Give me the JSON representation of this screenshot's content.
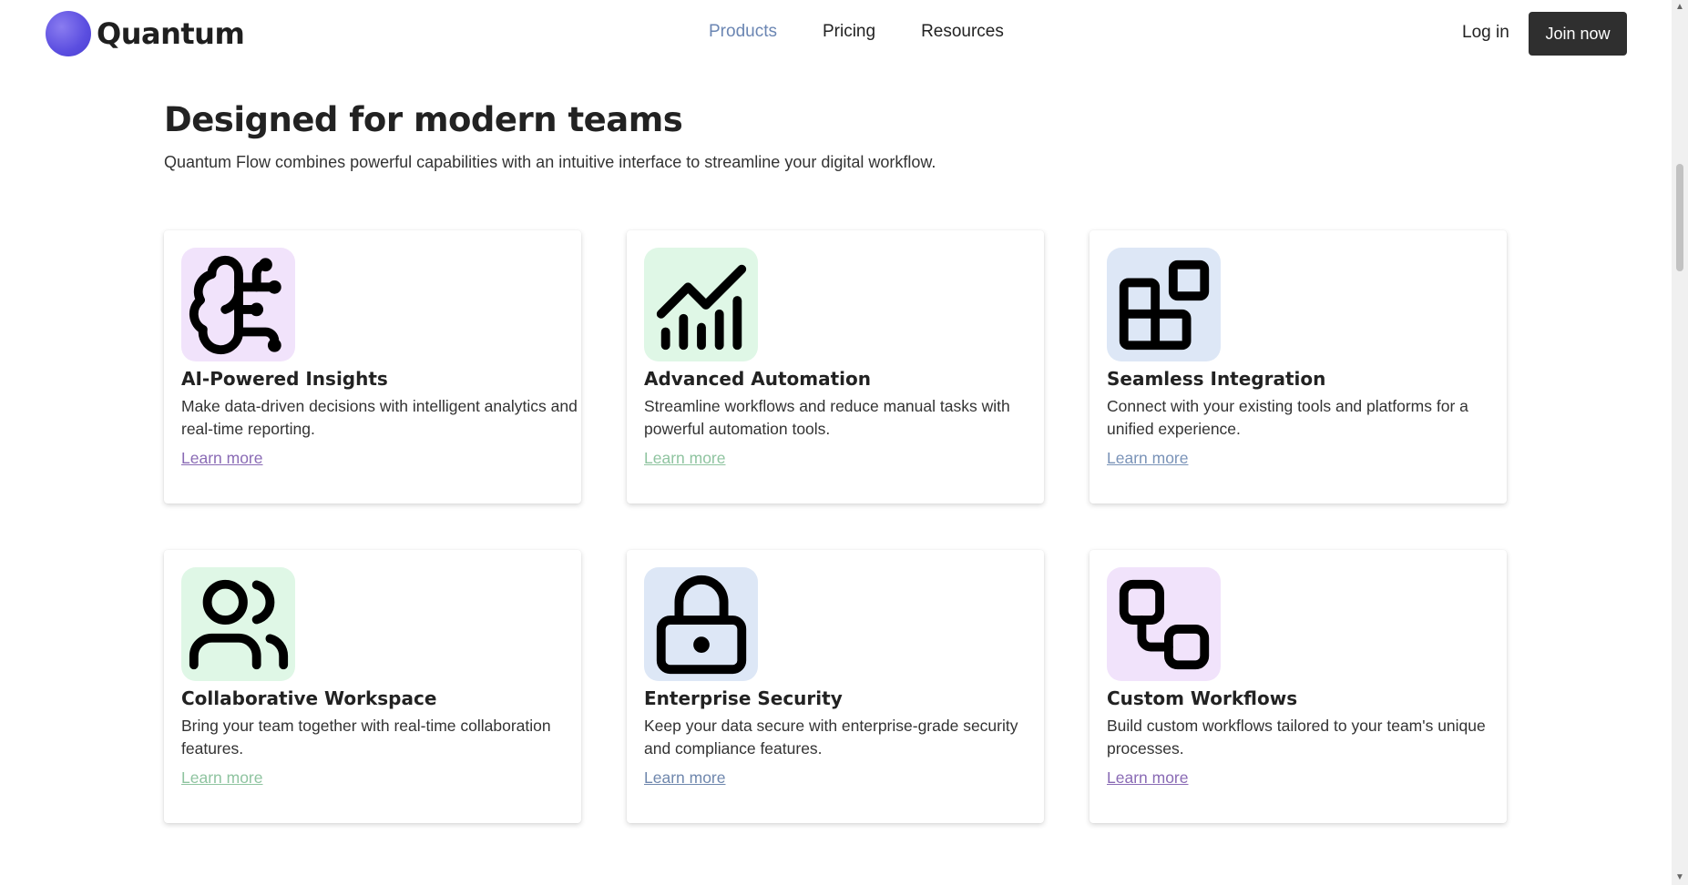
{
  "brand": {
    "name": "Quantum"
  },
  "nav": {
    "items": [
      {
        "label": "Products",
        "active": true
      },
      {
        "label": "Pricing",
        "active": false
      },
      {
        "label": "Resources",
        "active": false
      }
    ],
    "login_label": "Log in",
    "join_label": "Join now"
  },
  "section": {
    "title": "Designed for modern teams",
    "subtitle": "Quantum Flow combines powerful capabilities with an intuitive interface to streamline your digital workflow."
  },
  "features": [
    {
      "icon": "brain-circuit-icon",
      "icon_bg": "#f1e3fb",
      "link_color": "#8a6bb5",
      "title": "AI-Powered Insights",
      "description": "Make data-driven decisions with intelligent analytics and real-time reporting.",
      "link": "Learn more"
    },
    {
      "icon": "chart-growth-icon",
      "icon_bg": "#dff7e6",
      "link_color": "#8fc4a0",
      "title": "Advanced Automation",
      "description": "Streamline workflows and reduce manual tasks with powerful automation tools.",
      "link": "Learn more"
    },
    {
      "icon": "blocks-icon",
      "icon_bg": "#dde7f6",
      "link_color": "#7a93b8",
      "title": "Seamless Integration",
      "description": "Connect with your existing tools and platforms for a unified experience.",
      "link": "Learn more"
    },
    {
      "icon": "users-icon",
      "icon_bg": "#dff7e6",
      "link_color": "#8fc4a0",
      "title": "Collaborative Workspace",
      "description": "Bring your team together with real-time collaboration features.",
      "link": "Learn more"
    },
    {
      "icon": "lock-icon",
      "icon_bg": "#dde7f6",
      "link_color": "#6f87ad",
      "title": "Enterprise Security",
      "description": "Keep your data secure with enterprise-grade security and compliance features.",
      "link": "Learn more"
    },
    {
      "icon": "workflow-icon",
      "icon_bg": "#f1e3fb",
      "link_color": "#8a6bb5",
      "title": "Custom Workflows",
      "description": "Build custom workflows tailored to your team's unique processes.",
      "link": "Learn more"
    }
  ]
}
